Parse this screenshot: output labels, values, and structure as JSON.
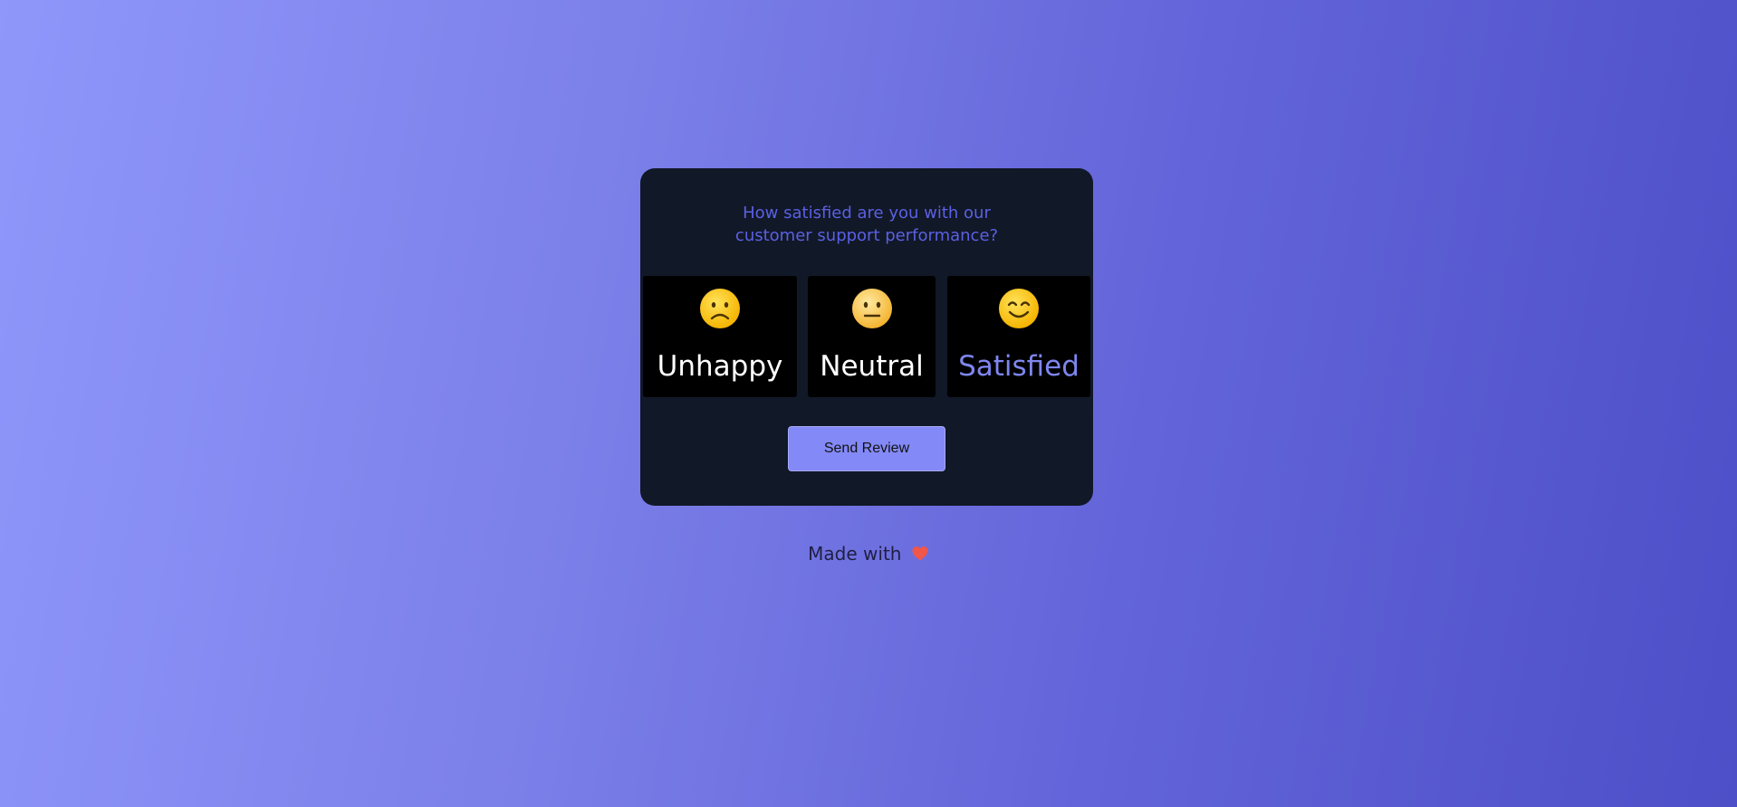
{
  "survey": {
    "question_line1": "How satisfied are you with our",
    "question_line2": "customer support performance?",
    "options": [
      {
        "label": "Unhappy",
        "icon": "frowning-face-icon",
        "selected": false
      },
      {
        "label": "Neutral",
        "icon": "neutral-face-icon",
        "selected": false
      },
      {
        "label": "Satisfied",
        "icon": "smiling-face-icon",
        "selected": true
      }
    ],
    "submit_label": "Send Review"
  },
  "footer": {
    "text": "Made with",
    "icon": "heart-icon"
  },
  "colors": {
    "card_background": "#111827",
    "question_text": "#5b60e3",
    "selected_label": "#7e86ee",
    "button_background": "#8389f6",
    "heart": "#f0564a"
  }
}
